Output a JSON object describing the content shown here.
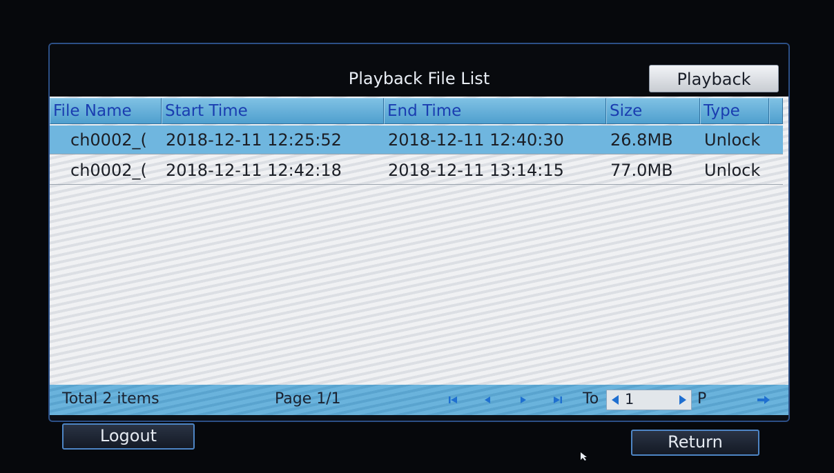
{
  "window": {
    "title": "Playback File List",
    "playback_label": "Playback"
  },
  "table": {
    "columns": [
      "File Name",
      "Start Time",
      "End Time",
      "Size",
      "Type"
    ],
    "rows": [
      {
        "file_name": "ch0002_(",
        "start_time": "2018-12-11 12:25:52",
        "end_time": "2018-12-11 12:40:30",
        "size": "26.8MB",
        "type": "Unlock"
      },
      {
        "file_name": "ch0002_(",
        "start_time": "2018-12-11 12:42:18",
        "end_time": "2018-12-11 13:14:15",
        "size": "77.0MB",
        "type": "Unlock"
      }
    ]
  },
  "footer": {
    "total": "Total 2 items",
    "page": "Page 1/1",
    "to_label": "To",
    "page_value": "1",
    "p_label": "P"
  },
  "buttons": {
    "logout": "Logout",
    "return": "Return"
  },
  "colors": {
    "header": "#58a8d6",
    "selected_row": "#6fb6df",
    "icon_blue": "#1f6fd0",
    "accent_border": "#4e86c6"
  },
  "icons": [
    "first-page-icon",
    "prev-page-icon",
    "next-page-icon",
    "last-page-icon",
    "spin-left-icon",
    "spin-right-icon",
    "go-arrow-icon",
    "mouse-cursor-icon"
  ]
}
